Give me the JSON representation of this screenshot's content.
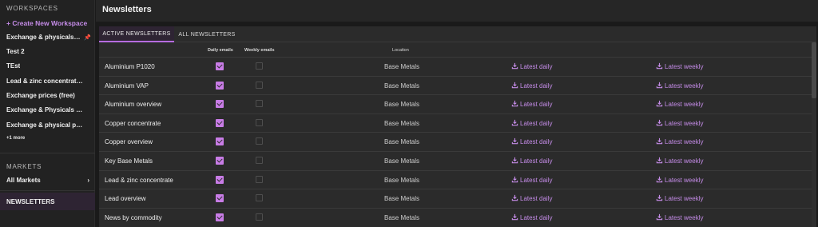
{
  "sidebar": {
    "workspaces_label": "WORKSPACES",
    "create_label": "+ Create New Workspace",
    "workspaces": [
      "Exchange & physicals ex...",
      "Test 2",
      "TEst",
      "Lead & zinc concentrate...",
      "Exchange prices (free)",
      "Exchange & Physicals ex...",
      "Exchange & physical pri..."
    ],
    "more_label": "+1 more",
    "markets_label": "MARKETS",
    "all_markets_label": "All Markets",
    "newsletters_label": "NEWSLETTERS"
  },
  "header": {
    "title": "Newsletters"
  },
  "tabs": [
    "ACTIVE NEWSLETTERS",
    "ALL NEWSLETTERS"
  ],
  "columns": {
    "daily": "Daily emails",
    "weekly": "Weekly emails",
    "location": "Location"
  },
  "link_labels": {
    "daily": "Latest daily",
    "weekly": "Latest weekly"
  },
  "rows": [
    {
      "name": "Aluminium P1020",
      "daily": true,
      "weekly": false,
      "location": "Base Metals"
    },
    {
      "name": "Aluminium VAP",
      "daily": true,
      "weekly": false,
      "location": "Base Metals"
    },
    {
      "name": "Aluminium overview",
      "daily": true,
      "weekly": false,
      "location": "Base Metals"
    },
    {
      "name": "Copper concentrate",
      "daily": true,
      "weekly": false,
      "location": "Base Metals"
    },
    {
      "name": "Copper overview",
      "daily": true,
      "weekly": false,
      "location": "Base Metals"
    },
    {
      "name": "Key Base Metals",
      "daily": true,
      "weekly": false,
      "location": "Base Metals"
    },
    {
      "name": "Lead & zinc concentrate",
      "daily": true,
      "weekly": false,
      "location": "Base Metals"
    },
    {
      "name": "Lead overview",
      "daily": true,
      "weekly": false,
      "location": "Base Metals"
    },
    {
      "name": "News by commodity",
      "daily": true,
      "weekly": false,
      "location": "Base Metals"
    }
  ],
  "colors": {
    "accent": "#c58ce8",
    "checkbox": "#c87ce6",
    "active_bg": "#2e2433"
  }
}
